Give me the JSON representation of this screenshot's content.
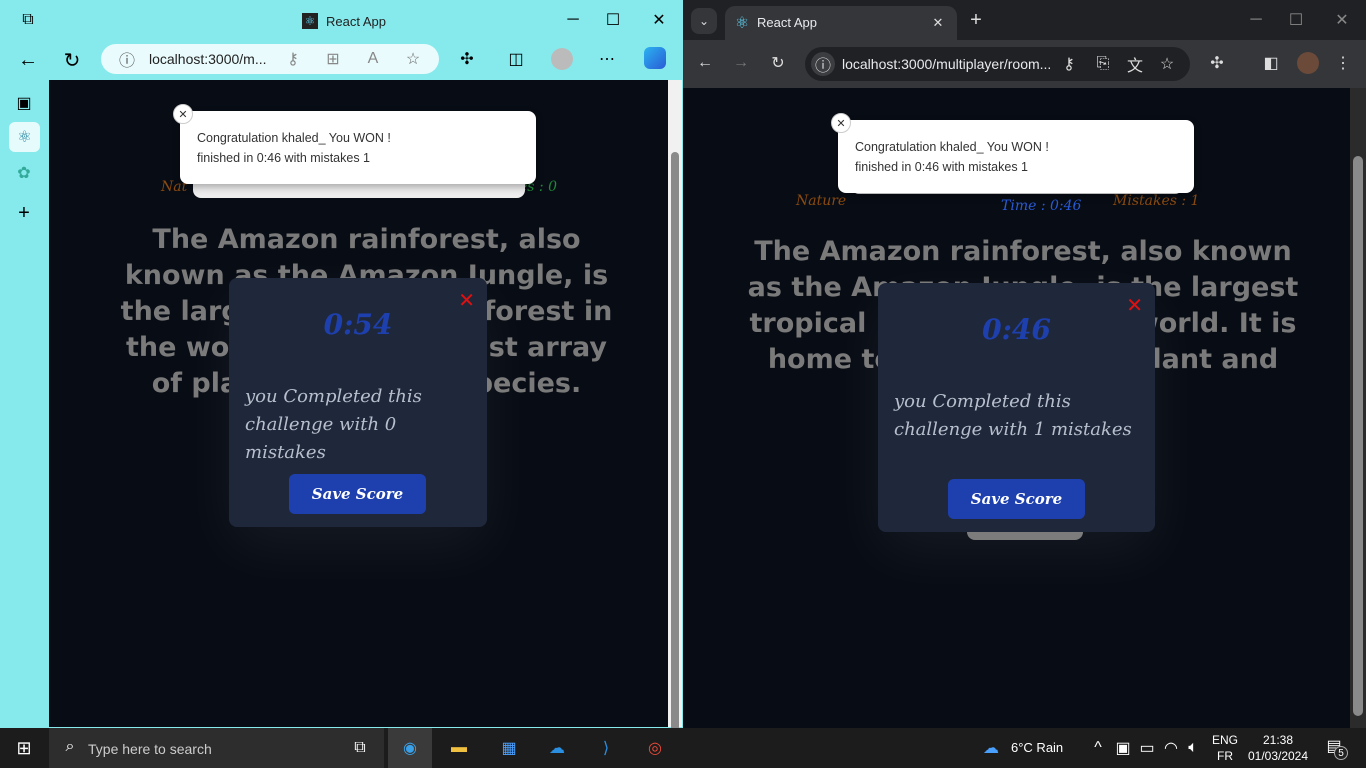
{
  "left_window": {
    "tab_title": "React App",
    "url": "localhost:3000/m...",
    "toast": {
      "title": "Congratulation khaled_ You WON !",
      "body": "finished in 0:46 with mistakes 1"
    },
    "stats": {
      "category": "Nat",
      "mistakes": "es : 0"
    },
    "paragraph": "The Amazon rainforest, also known as the Amazon Jungle, is the largest tropical rainforest in the world, home to a vast array of plant and animal species.",
    "modal": {
      "timer": "0:54",
      "message": "you Completed this challenge with 0 mistakes",
      "button": "Save Score"
    }
  },
  "right_window": {
    "tab_title": "React App",
    "url": "localhost:3000/multiplayer/room...",
    "toast": {
      "title": "Congratulation khaled_ You WON !",
      "body": "finished in 0:46 with mistakes 1"
    },
    "stats": {
      "category": "Nature",
      "time": "Time : 0:46",
      "mistakes": "Mistakes : 1"
    },
    "paragraph": "The Amazon rainforest, also known as the Amazon Jungle, is the largest tropical rainforest in the world. It is home to a vast array of plant and",
    "modal": {
      "timer": "0:46",
      "message": "you Completed this challenge with 1 mistakes",
      "button": "Save Score"
    }
  },
  "taskbar": {
    "search_placeholder": "Type here to search",
    "weather": "6°C  Rain",
    "lang1": "ENG",
    "lang2": "FR",
    "time": "21:38",
    "date": "01/03/2024",
    "notifications": "5"
  }
}
